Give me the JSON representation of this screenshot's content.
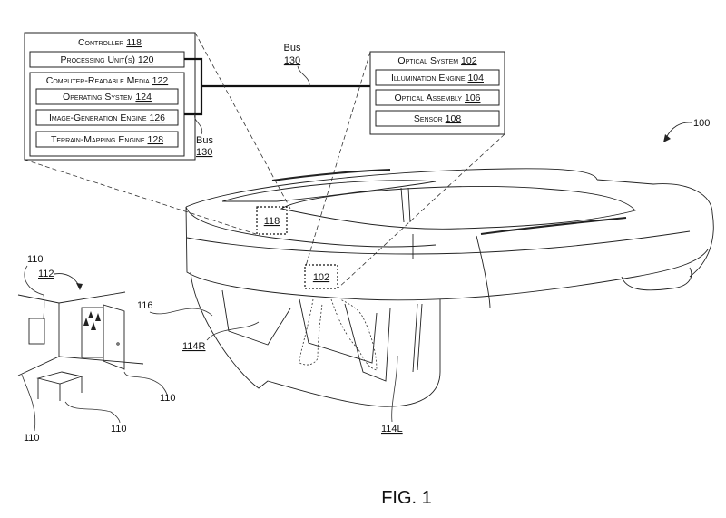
{
  "figure": {
    "caption": "FIG. 1",
    "device_ref": "100"
  },
  "controller": {
    "title": "Controller",
    "ref": "118",
    "processing_unit": {
      "label": "Processing Unit(s)",
      "ref": "120"
    },
    "media": {
      "title": "Computer-Readable Media",
      "ref": "122",
      "items": [
        {
          "label": "Operating System",
          "ref": "124"
        },
        {
          "label": "Image-Generation Engine",
          "ref": "126"
        },
        {
          "label": "Terrain-Mapping Engine",
          "ref": "128"
        }
      ]
    },
    "bus": {
      "label": "Bus",
      "ref": "130"
    }
  },
  "bus_main": {
    "label": "Bus",
    "ref": "130"
  },
  "optical_system": {
    "title": "Optical System",
    "ref": "102",
    "items": [
      {
        "label": "Illumination Engine",
        "ref": "104"
      },
      {
        "label": "Optical Assembly",
        "ref": "106"
      },
      {
        "label": "Sensor",
        "ref": "108"
      }
    ]
  },
  "device_labels": {
    "controller_marker": "118",
    "optical_marker": "102",
    "display_right": "114R",
    "display_left": "114L",
    "visor": "116"
  },
  "scene": {
    "environment_ref": "112",
    "object_refs": [
      "110",
      "110",
      "110",
      "110"
    ]
  }
}
